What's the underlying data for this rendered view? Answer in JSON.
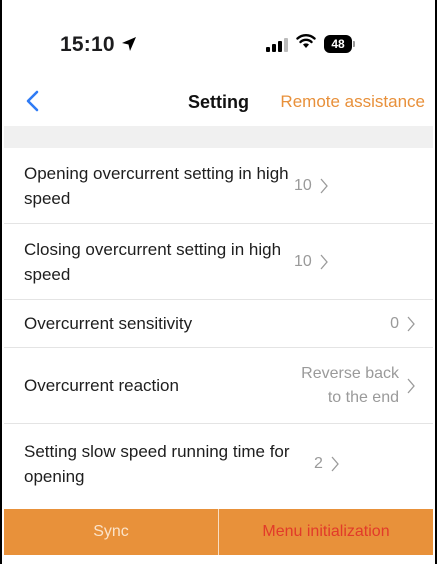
{
  "status_bar": {
    "time": "15:10",
    "battery": "48"
  },
  "nav": {
    "title": "Setting",
    "right_action": "Remote assistance"
  },
  "settings": [
    {
      "label": "Opening overcurrent setting in high speed",
      "value": "10"
    },
    {
      "label": "Closing overcurrent setting in high speed",
      "value": "10"
    },
    {
      "label": "Overcurrent sensitivity",
      "value": "0"
    },
    {
      "label": "Overcurrent reaction",
      "value": "Reverse back to the end"
    },
    {
      "label": "Setting slow speed running time for opening",
      "value": "2"
    }
  ],
  "footer": {
    "sync_label": "Sync",
    "menu_init_label": "Menu initialization"
  },
  "colors": {
    "accent": "#e8913a",
    "danger": "#e23a2a",
    "value_gray": "#9a9a9a"
  }
}
